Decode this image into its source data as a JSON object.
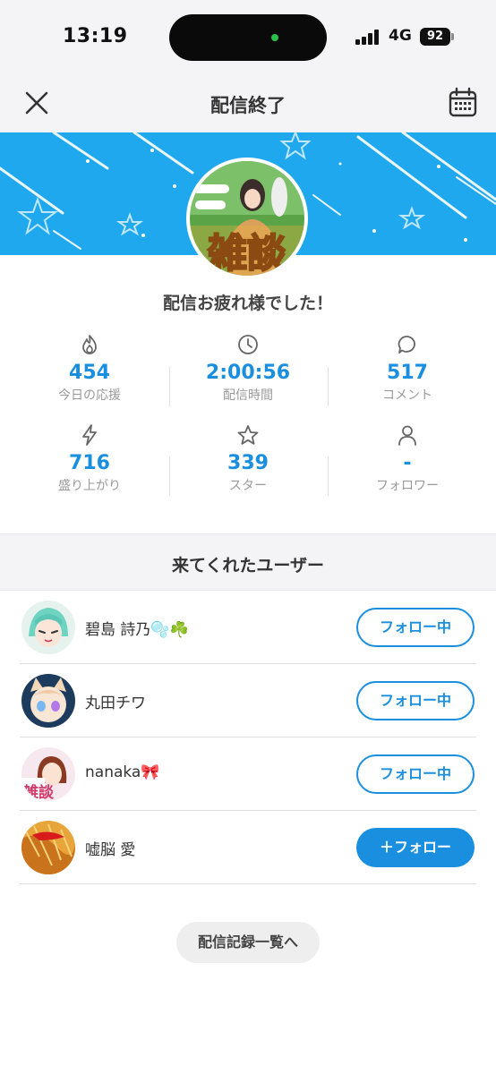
{
  "status_bar": {
    "time": "13:19",
    "network": "4G",
    "battery": "92"
  },
  "header": {
    "title": "配信終了",
    "close_icon": "close-icon",
    "calendar_icon": "calendar-icon"
  },
  "banner": {
    "color": "#1fa8ee",
    "avatar_text": "雑談"
  },
  "summary": {
    "message": "配信お疲れ様でした！",
    "stats": [
      {
        "icon": "flame-icon",
        "value": "454",
        "label": "今日の応援"
      },
      {
        "icon": "clock-icon",
        "value": "2:00:56",
        "label": "配信時間"
      },
      {
        "icon": "comment-icon",
        "value": "517",
        "label": "コメント"
      },
      {
        "icon": "lightning-icon",
        "value": "716",
        "label": "盛り上がり"
      },
      {
        "icon": "star-icon",
        "value": "339",
        "label": "スター"
      },
      {
        "icon": "person-icon",
        "value": "-",
        "label": "フォロワー"
      }
    ]
  },
  "users": {
    "title": "来てくれたユーザー",
    "list": [
      {
        "name": "碧島 詩乃🫧☘️",
        "button": "フォロー中"
      },
      {
        "name": "丸田チワ",
        "button": "フォロー中"
      },
      {
        "name": "nanaka🎀",
        "button": "フォロー中"
      },
      {
        "name": "嘘脳 愛",
        "button": "＋フォロー"
      }
    ]
  },
  "footer": {
    "history_button": "配信記録一覧へ"
  },
  "colors": {
    "accent": "#1a8fe0",
    "banner": "#1fa8ee"
  }
}
